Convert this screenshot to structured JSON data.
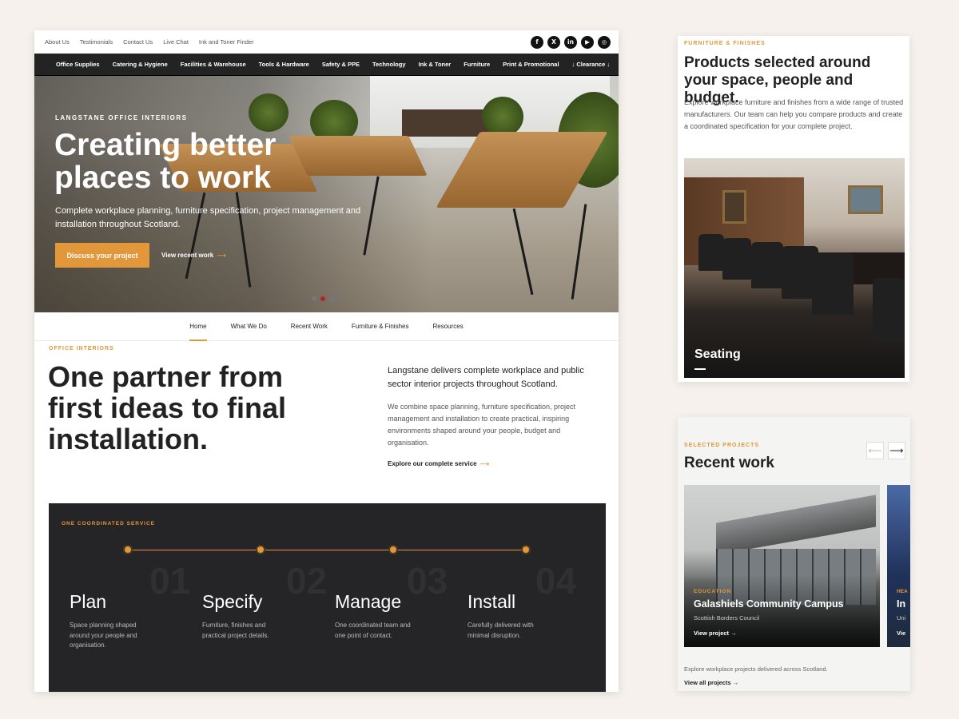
{
  "utility_nav": [
    "About Us",
    "Testimonials",
    "Contact Us",
    "Live Chat",
    "Ink and Toner Finder"
  ],
  "social": [
    {
      "icon": "facebook-icon",
      "glyph": "f"
    },
    {
      "icon": "x-icon",
      "glyph": "X"
    },
    {
      "icon": "linkedin-icon",
      "glyph": "in"
    },
    {
      "icon": "youtube-icon",
      "glyph": "▶"
    },
    {
      "icon": "instagram-icon",
      "glyph": "◎"
    }
  ],
  "main_nav": [
    "Office Supplies",
    "Catering & Hygiene",
    "Facilities & Warehouse",
    "Tools & Hardware",
    "Safety & PPE",
    "Technology",
    "Ink & Toner",
    "Furniture",
    "Print & Promotional",
    "↓ Clearance ↓"
  ],
  "hero": {
    "kicker": "LANGSTANE OFFICE INTERIORS",
    "title": "Creating better places to work",
    "subtitle": "Complete workplace planning, furniture specification, project management and installation throughout Scotland.",
    "cta": "Discuss your project",
    "link": "View recent work",
    "arrow": "⟶",
    "slides": 4,
    "active_slide": 2
  },
  "sub_nav": {
    "items": [
      "Home",
      "What We Do",
      "Recent Work",
      "Furniture & Finishes",
      "Resources"
    ],
    "active": "Home"
  },
  "intro": {
    "kicker": "OFFICE INTERIORS",
    "title": "One partner from first ideas to final installation.",
    "lead": "Langstane delivers complete workplace and public sector interior projects throughout Scotland.",
    "body": "We combine space planning, furniture specification, project management and installation to create practical, inspiring environments shaped around your people, budget and organisation.",
    "link": "Explore our complete service"
  },
  "service": {
    "kicker": "ONE COORDINATED SERVICE",
    "steps": [
      {
        "num": "01",
        "title": "Plan",
        "desc": "Space planning shaped around your people and organisation."
      },
      {
        "num": "02",
        "title": "Specify",
        "desc": "Furniture, finishes and practical project details."
      },
      {
        "num": "03",
        "title": "Manage",
        "desc": "One coordinated team and one point of contact."
      },
      {
        "num": "04",
        "title": "Install",
        "desc": "Carefully delivered with minimal disruption."
      }
    ]
  },
  "furniture": {
    "kicker": "FURNITURE & FINISHES",
    "title": "Products selected around your space, people and budget.",
    "body": "Explore workplace furniture and finishes from a wide range of trusted manufacturers. Our team can help you compare products and create a coordinated specification for your complete project.",
    "caption": "Seating"
  },
  "recent": {
    "kicker": "SELECTED PROJECTS",
    "title": "Recent work",
    "prev": "⟵",
    "next": "⟶",
    "cards": [
      {
        "kicker": "EDUCATION",
        "title": "Galashiels Community Campus",
        "sub": "Scottish Borders Council",
        "link": "View project →"
      },
      {
        "kicker": "HEA",
        "title": "In",
        "sub": "Uni",
        "link": "Vie"
      }
    ],
    "footer": "Explore workplace projects delivered across Scotland.",
    "link": "View all projects →"
  },
  "colors": {
    "accent": "#e2983a",
    "dark": "#252527",
    "nav": "#232323",
    "dot_active": "#b52323"
  }
}
